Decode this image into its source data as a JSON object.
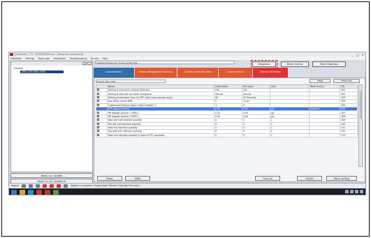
{
  "window": {
    "title": "[Pathfinder] - C:\\...\\ISUZU\\Pathfinder - [Idling fine adjustment]",
    "controls": [
      "_",
      "□",
      "×"
    ]
  },
  "menu": [
    "Pathfinder",
    "Settings",
    "Fault code",
    "Information",
    "Troubleshooting",
    "Service",
    "Help"
  ],
  "left_panel": {
    "buttons": [
      "+",
      "-"
    ],
    "tree_root": "4 Engine",
    "tree_selected": "4HK1-TCN 4HK1 4HE1",
    "read_update": "Read n.a / Update",
    "read_all_update": "Read n.a all / Update all"
  },
  "main": {
    "path": "Selected Equipment: Engine 4HK1-TCN",
    "diagnose": "Diagnose",
    "black_memo": "Black memo",
    "new_diagnose": "New Diagnose",
    "tabs": [
      "Customization",
      "Initial settings/Initial learning",
      "Custom protection data",
      "Learned Value",
      "Injector correction"
    ],
    "dropdown": "Engine 4HK1-TCN",
    "help": "Help",
    "print_list": "Print List"
  },
  "table": {
    "headers": [
      "",
      "Name",
      "Initial value",
      "Set value",
      "Unit",
      "Write to ECU",
      "No."
    ],
    "rows": [
      {
        "name": "Setting of economic running (Velocity)",
        "initial": "ON",
        "set": "ON",
        "unit": "",
        "write": "",
        "no": "001"
      },
      {
        "name": "Setting of pilot idle up mode changeover",
        "initial": "Manual",
        "set": "Manual",
        "unit": "",
        "write": "",
        "no": "002"
      },
      {
        "name": "Setting of activation time for DPF start (Auto manual mode)",
        "initial": "60",
        "set": "60 Seconds",
        "unit": "",
        "write": "",
        "no": "003"
      },
      {
        "name": "Low idling control RPM",
        "initial": "0",
        "set": "0 rpm",
        "unit": "",
        "write": "",
        "no": "004"
      },
      {
        "name": "Customized Startup Ideas 2 byte 0 digit(0) 1",
        "initial": "1",
        "set": "0",
        "unit": "",
        "write": "",
        "no": "005"
      },
      {
        "name": "DPF deposit volume",
        "initial": "0.00",
        "set": "0.00",
        "unit": "g/L",
        "write": "Absolute",
        "no": "006",
        "selected": true
      },
      {
        "name": "PM deposit volume 1 (HPEC)",
        "initial": "0.00",
        "set": "0.00",
        "unit": "g/L",
        "write": "",
        "no": "007"
      },
      {
        "name": "PM deposit volume 2 (HPEC)",
        "initial": "0.00",
        "set": "0.00",
        "unit": "g/L",
        "write": "",
        "no": "008"
      },
      {
        "name": "Total idle fuel injection quantity",
        "initial": "0",
        "set": "0",
        "unit": "L",
        "write": "",
        "no": "009"
      },
      {
        "name": "Trip idle fuel injection quantity",
        "initial": "0",
        "set": "0",
        "unit": "L",
        "write": "",
        "no": "010"
      },
      {
        "name": "Total fuel injection quantity",
        "initial": "0",
        "set": "0",
        "unit": "L",
        "write": "",
        "no": "011"
      },
      {
        "name": "Trip total fuel injection quantity",
        "initial": "0",
        "set": "0",
        "unit": "L",
        "write": "",
        "no": "012"
      },
      {
        "name": "Total fuel injection quantity in case of PTO operation",
        "initial": "0",
        "set": "0",
        "unit": "L",
        "write": "",
        "no": "013"
      }
    ]
  },
  "footer": {
    "reset": "Reset",
    "write": "Write",
    "save_as": "Save as",
    "delete": "Delete",
    "batch_writing": "Batch writing"
  },
  "status": {
    "left": "Engine",
    "message": "Update is complete. Choose item \"Revise\" from the File menu."
  },
  "colors": {
    "tab_active": "#2f6ea8",
    "tab_inactive": "#e2572d",
    "selected_row": "#3b7dd8",
    "highlight": "#e01010"
  }
}
